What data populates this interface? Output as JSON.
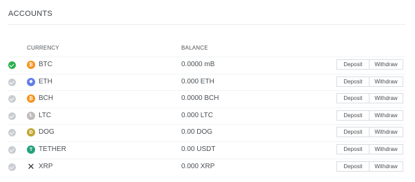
{
  "header": {
    "title": "ACCOUNTS"
  },
  "columns": {
    "currency": "CURRENCY",
    "balance": "BALANCE"
  },
  "actions": {
    "deposit_label": "Deposit",
    "withdraw_label": "Withdraw"
  },
  "accounts": [
    {
      "symbol": "BTC",
      "icon": "bitcoin-icon",
      "glyph": "₿",
      "color": "#f7931a",
      "balance": "0.0000 mB",
      "selected": true
    },
    {
      "symbol": "ETH",
      "icon": "ethereum-icon",
      "glyph": "◆",
      "color": "#627eea",
      "balance": "0.000 ETH",
      "selected": false
    },
    {
      "symbol": "BCH",
      "icon": "bitcoin-cash-icon",
      "glyph": "₿",
      "color": "#f7931a",
      "balance": "0.0000 BCH",
      "selected": false
    },
    {
      "symbol": "LTC",
      "icon": "litecoin-icon",
      "glyph": "Ł",
      "color": "#bfbbbb",
      "balance": "0.000 LTC",
      "selected": false
    },
    {
      "symbol": "DOG",
      "icon": "dogecoin-icon",
      "glyph": "Ð",
      "color": "#c2a633",
      "balance": "0.00 DOG",
      "selected": false
    },
    {
      "symbol": "TETHER",
      "icon": "tether-icon",
      "glyph": "T",
      "color": "#26a17b",
      "balance": "0.00 USDT",
      "selected": false
    },
    {
      "symbol": "XRP",
      "icon": "xrp-icon",
      "glyph": "✕",
      "color": "#333333",
      "balance": "0.000 XRP",
      "selected": false
    }
  ]
}
